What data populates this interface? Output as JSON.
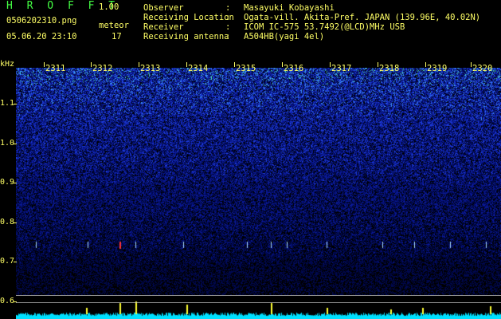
{
  "header": {
    "app_title": "H R O F F T",
    "version": "1.00",
    "file_name": "0506202310.png",
    "date_time": "05.06.20 23:10",
    "meteor_label": "meteor",
    "meteor_count": "17"
  },
  "info": [
    {
      "label": "Observer",
      "value": "Masayuki Kobayashi"
    },
    {
      "label": "Receiving Location",
      "value": "Ogata-vill. Akita-Pref. JAPAN (139.96E, 40.02N)"
    },
    {
      "label": "Receiver",
      "value": "ICOM IC-575 53.7492(@LCD)MHz USB"
    },
    {
      "label": "Receiving antenna",
      "value": "A504HB(yagi 4el)"
    }
  ],
  "colon": ":",
  "axis": {
    "unit": "kHz",
    "freq_labels": [
      "1.1",
      "1.0",
      "0.9",
      "0.8",
      "0.7",
      "0.6"
    ],
    "time_labels": [
      "2311",
      "2312",
      "2313",
      "2314",
      "2315",
      "2316",
      "2317",
      "2318",
      "2319",
      "2320"
    ]
  },
  "colors": {
    "text": "#ffff66",
    "title": "#44ff44",
    "background": "#000000",
    "spectrum_base": "#1020a0",
    "strip": "#00e0ff"
  }
}
